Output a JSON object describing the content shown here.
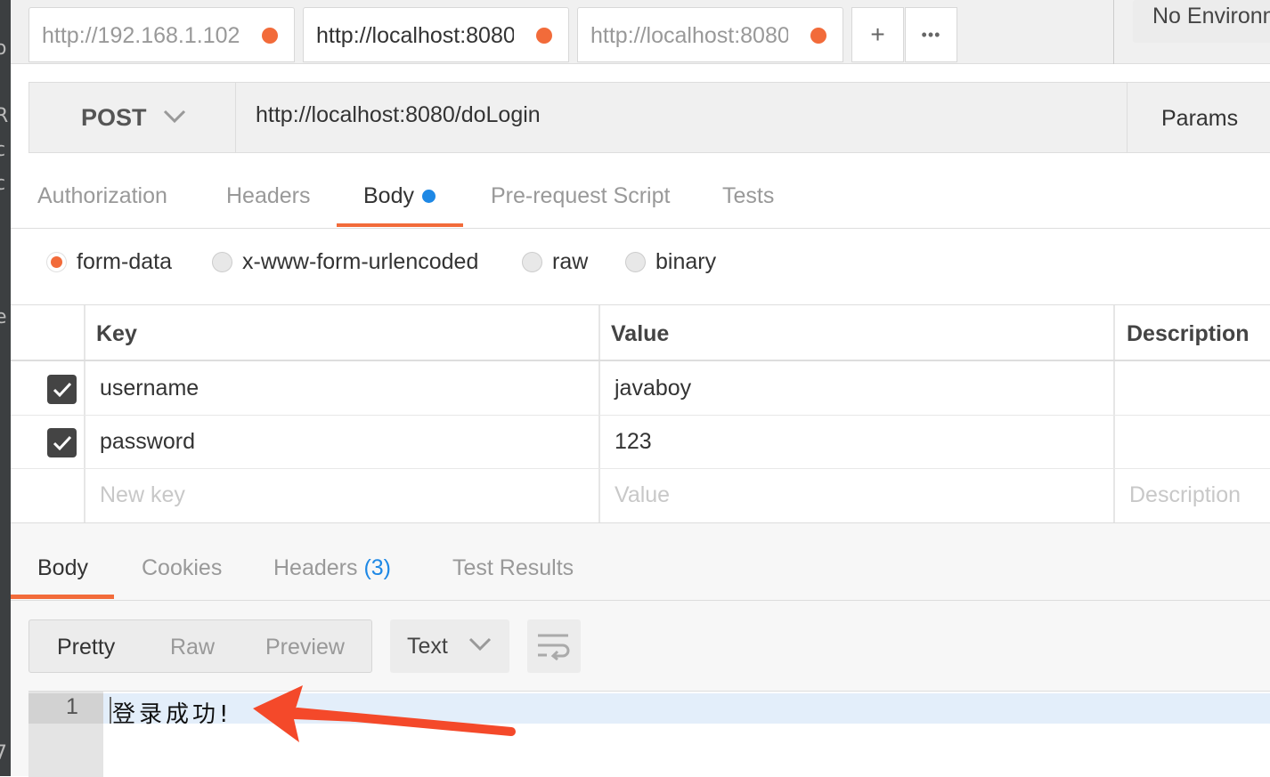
{
  "tabs": [
    {
      "url": "http://192.168.1.102",
      "active": false,
      "unsaved": true
    },
    {
      "url": "http://localhost:8080",
      "active": true,
      "unsaved": true
    },
    {
      "url": "http://localhost:8080",
      "active": false,
      "unsaved": true
    }
  ],
  "tab_actions": {
    "new_tab": "+",
    "more": "•••"
  },
  "environment": {
    "selected": "No Environment"
  },
  "request": {
    "method": "POST",
    "url": "http://localhost:8080/doLogin",
    "params_label": "Params"
  },
  "request_tabs": [
    {
      "label": "Authorization"
    },
    {
      "label": "Headers"
    },
    {
      "label": "Body",
      "active": true
    },
    {
      "label": "Pre-request Script"
    },
    {
      "label": "Tests"
    }
  ],
  "body_modes": [
    {
      "label": "form-data",
      "selected": true
    },
    {
      "label": "x-www-form-urlencoded"
    },
    {
      "label": "raw"
    },
    {
      "label": "binary"
    }
  ],
  "form_table": {
    "headers": {
      "key": "Key",
      "value": "Value",
      "description": "Description"
    },
    "rows": [
      {
        "checked": true,
        "key": "username",
        "value": "javaboy",
        "description": ""
      },
      {
        "checked": true,
        "key": "password",
        "value": "123",
        "description": ""
      }
    ],
    "placeholders": {
      "key": "New key",
      "value": "Value",
      "description": "Description"
    }
  },
  "response_tabs": [
    {
      "label": "Body",
      "active": true
    },
    {
      "label": "Cookies"
    },
    {
      "label": "Headers",
      "count": "(3)"
    },
    {
      "label": "Test Results"
    }
  ],
  "response_view": {
    "formats": [
      "Pretty",
      "Raw",
      "Preview"
    ],
    "active_format": "Pretty",
    "language": "Text"
  },
  "response_body": {
    "line_number": "1",
    "text": "登录成功!"
  },
  "colors": {
    "accent": "#f26b3a",
    "blue_dot": "#1e88e5",
    "arrow": "#f4492a"
  }
}
